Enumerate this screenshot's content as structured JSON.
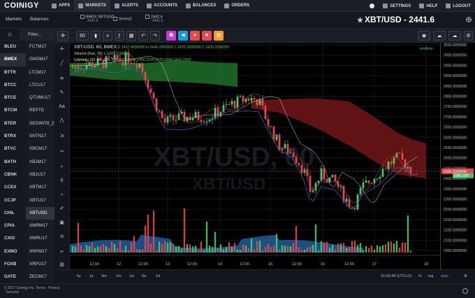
{
  "topnav": {
    "logo": "COINIGY",
    "left": [
      {
        "label": "APPS",
        "icon": "grid-icon"
      },
      {
        "label": "MARKETS",
        "icon": "chart-icon"
      },
      {
        "label": "ALERTS",
        "icon": "bell-icon"
      },
      {
        "label": "ACCOUNTS",
        "icon": "key-icon"
      },
      {
        "label": "BALANCES",
        "icon": "wallet-icon"
      },
      {
        "label": "ORDERS",
        "icon": "list-icon"
      }
    ],
    "right": [
      {
        "label": "SETTINGS",
        "icon": "gear-icon"
      },
      {
        "label": "HELP",
        "icon": "question-icon"
      },
      {
        "label": "LOGOUT",
        "icon": "power-icon"
      }
    ]
  },
  "left_tabs": {
    "markets": "Markets",
    "balances": "Balances"
  },
  "chart_tabs": [
    {
      "title": "BMEX:XBT/USD",
      "sub": "2441.6"
    },
    {
      "title": "Series2",
      "sub": ""
    },
    {
      "title": "2442.6",
      "sub": "2441.5"
    }
  ],
  "pair_title": "XBT/USD - 2441.6",
  "filter_placeholder": "Filter...",
  "exchanges": [
    "BLEU",
    "BMEX",
    "BTTR",
    "BTCC",
    "BTCE",
    "BTCM",
    "BTER",
    "BTRX",
    "BTVC",
    "BXTH",
    "CBNK",
    "CCEX",
    "CCJP",
    "CHIL",
    "CPIA",
    "CXIO",
    "EXMO",
    "FOXB",
    "GATE",
    "GDAX"
  ],
  "selected_exchange": "BMEX",
  "markets": [
    "FCTM17",
    "GNOM17",
    "LTCM17",
    "LTCU17",
    "QTUMU17",
    "REP7D",
    "SEGWIT8_Z",
    "SNTN17",
    "XBCM17",
    "XBJM17",
    "XBJU17",
    "XBTM17",
    "XBTU17",
    "XBTUSD",
    "XMRM17",
    "XMRU17",
    "XRPM17",
    "XRPU17",
    "ZECM17",
    "ZECU17"
  ],
  "selected_market": "XBTUSD",
  "footer": {
    "copyright": "© 2017 Coinigy Inc. Terms - Privacy - Security"
  },
  "toolbar": {
    "interval": "60",
    "buttons": [
      "cursor-icon",
      "bar-type-icon",
      "compare-icon",
      "indicators-icon",
      "template-icon",
      "undo-icon",
      "redo-icon"
    ],
    "colored": [
      {
        "icon": "hexagon-icon",
        "color": "#c53ad4"
      },
      {
        "icon": "megaphone-icon",
        "color": "#1d9bd8"
      },
      {
        "icon": "record-icon",
        "color": "#e24b4b"
      },
      {
        "icon": "stop-icon",
        "color": "#e24b4b"
      },
      {
        "icon": "grid-icon",
        "color": "#f39c2a"
      }
    ]
  },
  "legends": {
    "main": "XBT/USD, 60, BMEX",
    "ohlc": "O 2437.4000000  H 2446.2000000  L 2435.2000000  C 2435.2000000",
    "volume": "Volume (true, 20)",
    "volume_vals": "1.6906  3.0286K",
    "ichimoku": "Ichimoku (20, 60, 120, 30)",
    "ichimoku_vals": "2375.4000  2456.2500  2475.2000  2475.2000",
    "watermark_pair": "XBT/USD, 60",
    "watermark_sub": "XBT/USD",
    "realtime": "realtime"
  },
  "price_axis": {
    "ticks": [
      "3050.0000000",
      "3000.0000000",
      "2950.0000000",
      "2900.0000000",
      "2850.0000000",
      "2800.0000000",
      "2750.0000000",
      "2700.0000000",
      "2650.0000000",
      "2600.0000000",
      "2550.0000000",
      "2500.0000000",
      "2450.0000000",
      "2400.0000000",
      "2350.0000000",
      "2300.0000000",
      "2250.0000000",
      "2200.0000000",
      "2150.0000000",
      "2100.0000000",
      "2050.0000000"
    ],
    "last_price": "2435.2000000",
    "last_price_color": "#e2484d",
    "ichimoku_label": "2381.180",
    "ichimoku_label_color": "#4fc36b"
  },
  "time_axis": [
    "12:00",
    "12",
    "12:00",
    "13",
    "12:00",
    "14",
    "12:00",
    "15",
    "12:00",
    "16",
    "12:00",
    "17",
    "18"
  ],
  "bottom_bar": {
    "timeframes": [
      "5y",
      "1y",
      "3m",
      "1m",
      "1w",
      "5d",
      "1d"
    ],
    "clock": "16:50:48 (UTC+2)",
    "right": [
      "%",
      "log",
      "auto"
    ]
  },
  "colors": {
    "up": "#4fc36b",
    "down": "#e2484d",
    "cloud_bull": "#1f6f2a",
    "cloud_bear": "#6b1416",
    "volume_area": "#1e5d9c"
  }
}
